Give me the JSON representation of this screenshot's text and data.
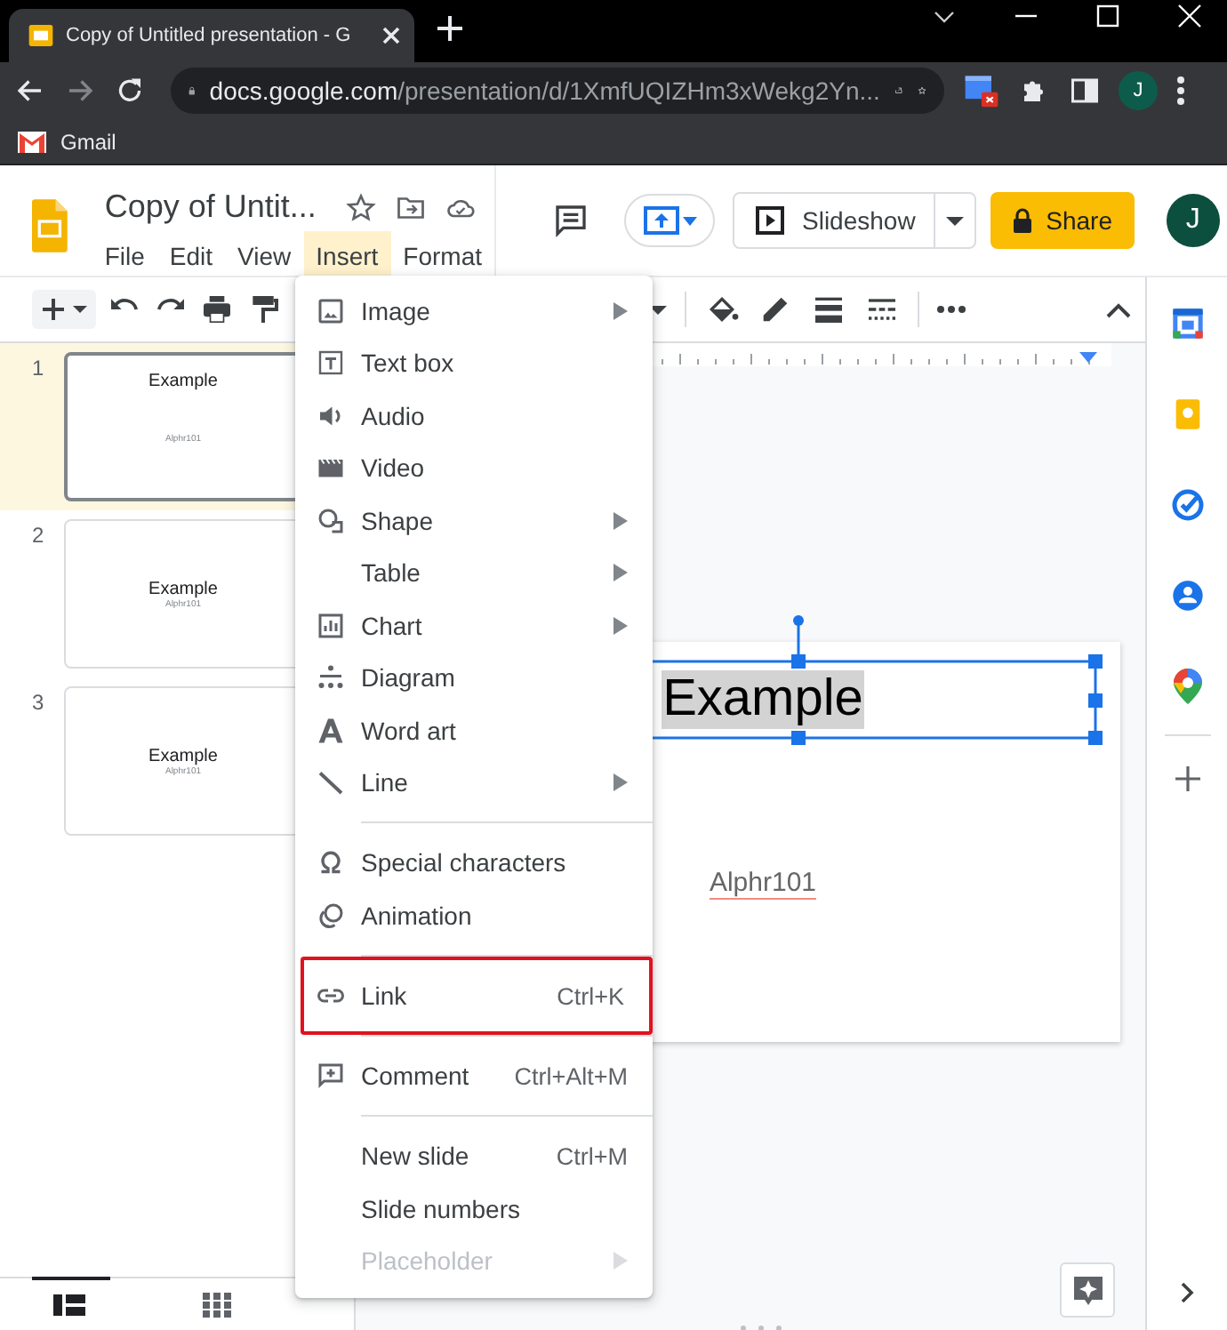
{
  "browser": {
    "tab": {
      "title": "Copy of Untitled presentation - G"
    },
    "address": {
      "host": "docs.google.com",
      "path": "/presentation/d/1XmfUQIZHm3xWekg2Yn..."
    },
    "profile": "J",
    "bookmarks": [
      {
        "label": "Gmail"
      }
    ]
  },
  "header": {
    "title": "Copy of Untit...",
    "menus": [
      {
        "label": "File",
        "selected": false
      },
      {
        "label": "Edit",
        "selected": false
      },
      {
        "label": "View",
        "selected": false
      },
      {
        "label": "Insert",
        "selected": true
      },
      {
        "label": "Format",
        "selected": false
      }
    ],
    "slideshow": "Slideshow",
    "share": "Share",
    "avatar": "J"
  },
  "filmstrip": [
    {
      "number": "1",
      "title": "Example",
      "subtitle": "Alphr101",
      "kind": "spread",
      "selected": true
    },
    {
      "number": "2",
      "title": "Example",
      "subtitle": "Alphr101",
      "kind": "stacked",
      "selected": false
    },
    {
      "number": "3",
      "title": "Example",
      "subtitle": "Alphr101",
      "kind": "stacked",
      "selected": false
    }
  ],
  "slide": {
    "title": "Example",
    "subtitle": "Alphr101",
    "title_selected": true
  },
  "insert_menu": [
    {
      "kind": "item",
      "label": "Image",
      "submenu": true,
      "disabled": false,
      "highlighted": false
    },
    {
      "kind": "item",
      "label": "Text box",
      "submenu": false,
      "disabled": false,
      "highlighted": false
    },
    {
      "kind": "item",
      "label": "Audio",
      "submenu": false,
      "disabled": false,
      "highlighted": false
    },
    {
      "kind": "item",
      "label": "Video",
      "submenu": false,
      "disabled": false,
      "highlighted": false
    },
    {
      "kind": "item",
      "label": "Shape",
      "submenu": true,
      "disabled": false,
      "highlighted": false
    },
    {
      "kind": "item",
      "label": "Table",
      "submenu": true,
      "disabled": false,
      "highlighted": false
    },
    {
      "kind": "item",
      "label": "Chart",
      "submenu": true,
      "disabled": false,
      "highlighted": false
    },
    {
      "kind": "item",
      "label": "Diagram",
      "submenu": false,
      "disabled": false,
      "highlighted": false
    },
    {
      "kind": "item",
      "label": "Word art",
      "submenu": false,
      "disabled": false,
      "highlighted": false
    },
    {
      "kind": "item",
      "label": "Line",
      "submenu": true,
      "disabled": false,
      "highlighted": false
    },
    {
      "kind": "separator"
    },
    {
      "kind": "item",
      "label": "Special characters",
      "submenu": false,
      "disabled": false,
      "highlighted": false
    },
    {
      "kind": "item",
      "label": "Animation",
      "submenu": false,
      "disabled": false,
      "highlighted": false
    },
    {
      "kind": "separator"
    },
    {
      "kind": "item",
      "label": "Link",
      "shortcut": "Ctrl+K",
      "submenu": false,
      "disabled": false,
      "highlighted": true
    },
    {
      "kind": "separator"
    },
    {
      "kind": "item",
      "label": "Comment",
      "shortcut": "Ctrl+Alt+M",
      "submenu": false,
      "disabled": false,
      "highlighted": false
    },
    {
      "kind": "separator"
    },
    {
      "kind": "item",
      "label": "New slide",
      "shortcut": "Ctrl+M",
      "submenu": false,
      "disabled": false,
      "highlighted": false
    },
    {
      "kind": "item",
      "label": "Slide numbers",
      "submenu": false,
      "disabled": false,
      "highlighted": false
    },
    {
      "kind": "item",
      "label": "Placeholder",
      "submenu": true,
      "disabled": true,
      "highlighted": false
    }
  ]
}
